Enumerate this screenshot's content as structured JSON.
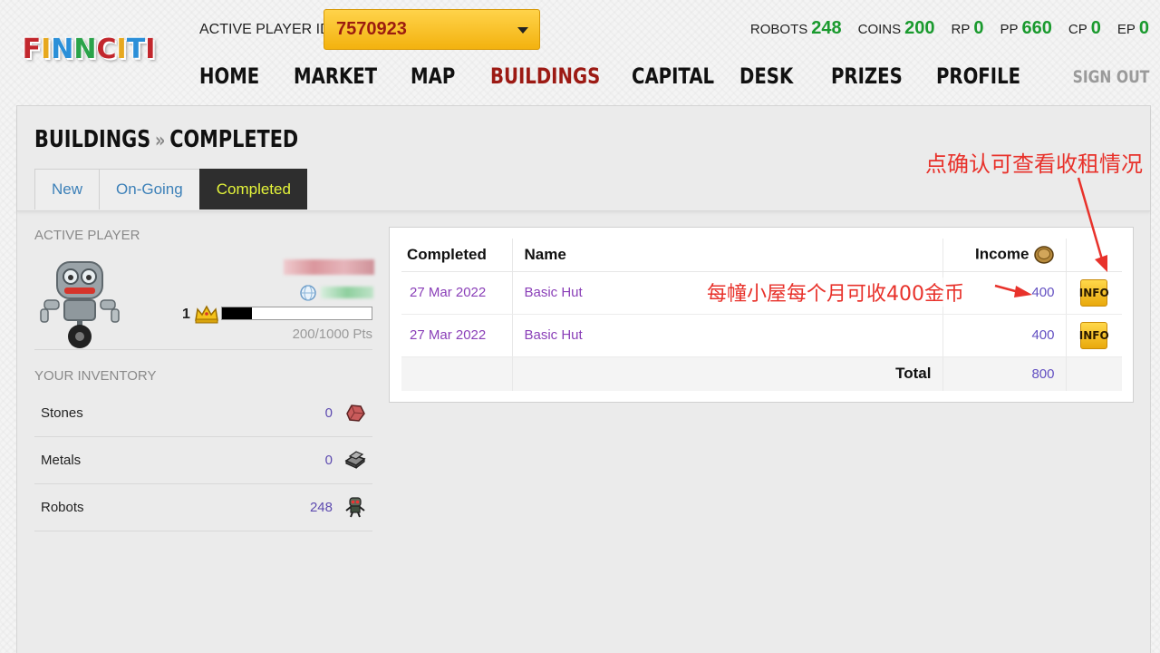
{
  "header": {
    "logo_text": "FINNCITI",
    "player_id_label": "ACTIVE PLAYER ID",
    "player_id_value": "7570923",
    "stats": [
      {
        "label": "ROBOTS",
        "value": "248"
      },
      {
        "label": "COINS",
        "value": "200"
      },
      {
        "label": "RP",
        "value": "0"
      },
      {
        "label": "PP",
        "value": "660"
      },
      {
        "label": "CP",
        "value": "0"
      },
      {
        "label": "EP",
        "value": "0"
      }
    ],
    "nav": [
      "HOME",
      "MARKET",
      "MAP",
      "BUILDINGS",
      "CAPITAL",
      "DESK",
      "PRIZES",
      "PROFILE"
    ],
    "active_nav": "BUILDINGS",
    "sign_out": "SIGN OUT"
  },
  "page": {
    "breadcrumb_section": "BUILDINGS",
    "breadcrumb_sep": "»",
    "breadcrumb_current": "COMPLETED",
    "tabs": [
      "New",
      "On-Going",
      "Completed"
    ],
    "active_tab": "Completed"
  },
  "sidebar": {
    "active_player_label": "ACTIVE PLAYER",
    "level": "1",
    "level_progress": 0.2,
    "points": "200/1000 Pts",
    "inventory_label": "YOUR INVENTORY",
    "inventory": [
      {
        "name": "Stones",
        "count": "0",
        "icon": "stone-icon"
      },
      {
        "name": "Metals",
        "count": "0",
        "icon": "metal-icon"
      },
      {
        "name": "Robots",
        "count": "248",
        "icon": "robot-icon"
      }
    ]
  },
  "table": {
    "headers": {
      "completed": "Completed",
      "name": "Name",
      "income": "Income"
    },
    "rows": [
      {
        "completed": "27 Mar 2022",
        "name": "Basic Hut",
        "income": "400",
        "action": "INFO"
      },
      {
        "completed": "27 Mar 2022",
        "name": "Basic Hut",
        "income": "400",
        "action": "INFO"
      }
    ],
    "total_label": "Total",
    "total_value": "800"
  },
  "annotations": {
    "top_note": "点确认可查看收租情况",
    "mid_note": "每幢小屋每个月可收400金币"
  },
  "colors": {
    "accent_green": "#1a9a2e",
    "nav_active": "#9c1a14",
    "select_gold": "#f3b20f",
    "annotation_red": "#e8322b",
    "link_purple": "#8a3fb8"
  }
}
